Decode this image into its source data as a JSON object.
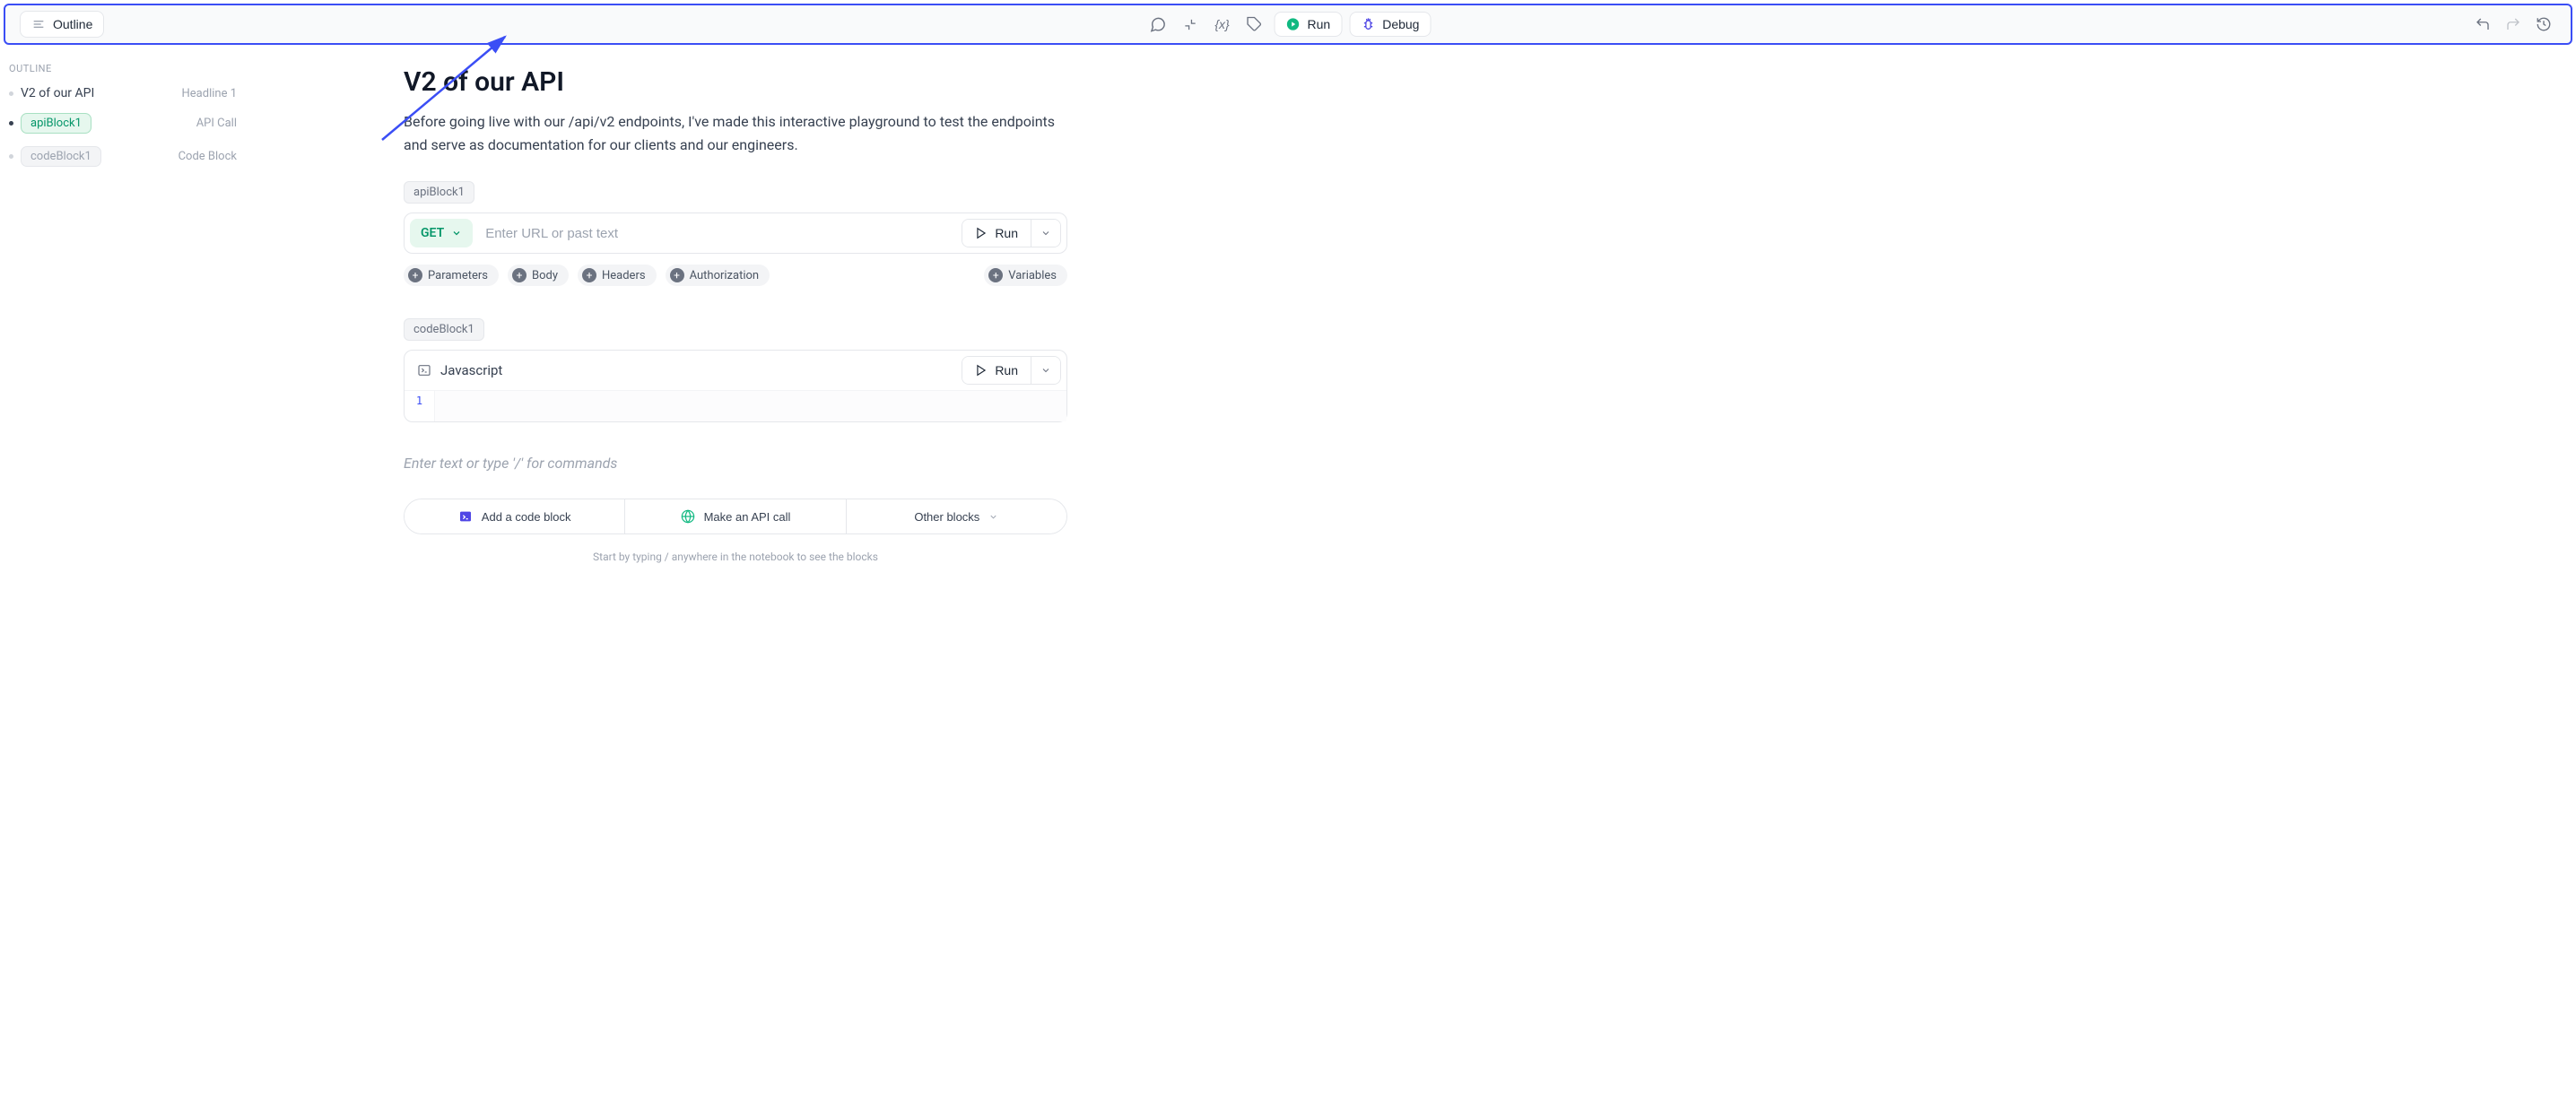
{
  "toolbar": {
    "outline_label": "Outline",
    "run_label": "Run",
    "debug_label": "Debug",
    "variable_glyph": "{x}"
  },
  "sidebar": {
    "header": "OUTLINE",
    "items": [
      {
        "label": "V2 of our API",
        "type_label": "Headline 1",
        "style": "text",
        "active": false
      },
      {
        "label": "apiBlock1",
        "type_label": "API Call",
        "style": "pill-green",
        "active": true
      },
      {
        "label": "codeBlock1",
        "type_label": "Code Block",
        "style": "pill-gray",
        "active": false
      }
    ]
  },
  "page": {
    "title": "V2 of our API",
    "intro": "Before going live with our /api/v2 endpoints, I've made this interactive playground to test the endpoints and serve as documentation for our clients and our engineers."
  },
  "api_block": {
    "label": "apiBlock1",
    "method": "GET",
    "url_placeholder": "Enter URL or past text",
    "run_label": "Run",
    "chips": [
      "Parameters",
      "Body",
      "Headers",
      "Authorization"
    ],
    "variables_chip": "Variables"
  },
  "code_block": {
    "label": "codeBlock1",
    "language": "Javascript",
    "run_label": "Run",
    "line_number": "1"
  },
  "prompt": {
    "placeholder": "Enter text or type '/' for commands"
  },
  "bottom": {
    "add_code": "Add a code block",
    "make_api": "Make an API call",
    "other": "Other blocks"
  },
  "hint": "Start by typing / anywhere in the notebook to see the blocks"
}
